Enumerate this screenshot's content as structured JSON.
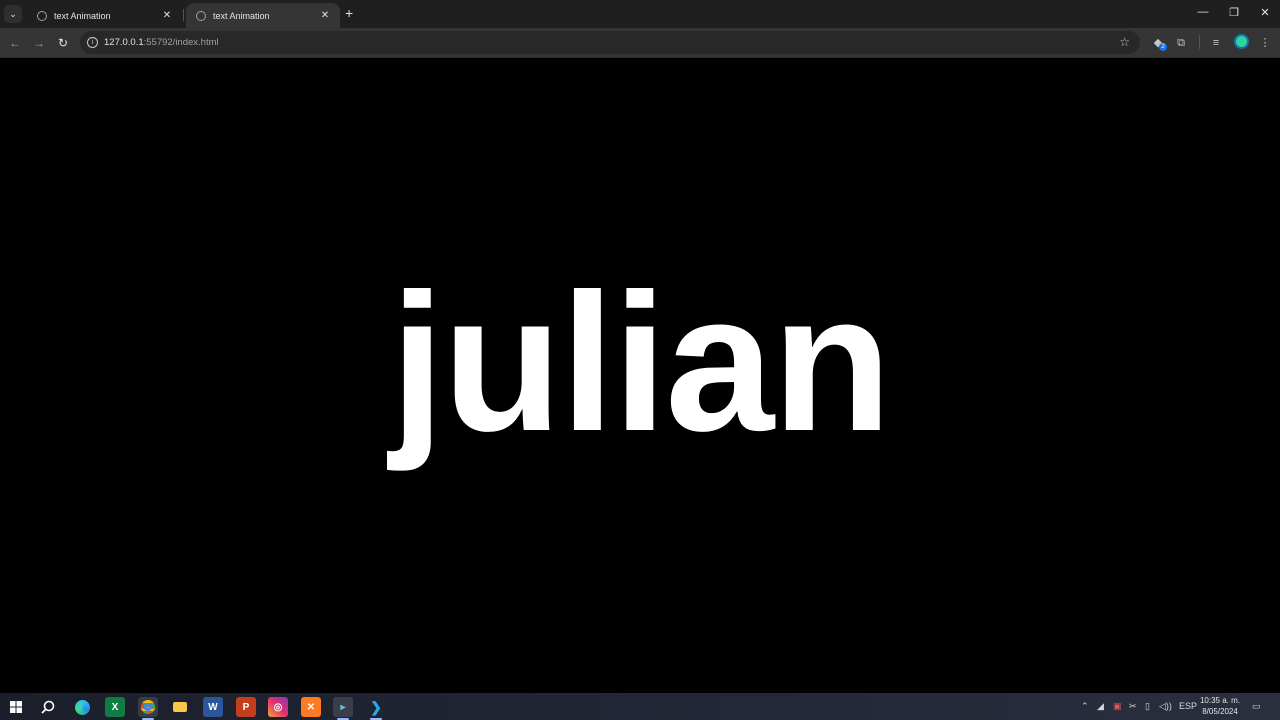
{
  "tabs": [
    {
      "title": "text Animation",
      "close": "✕"
    },
    {
      "title": "text Animation",
      "close": "✕"
    }
  ],
  "new_tab_glyph": "+",
  "window_controls": {
    "minimize": "—",
    "restore": "❐",
    "close": "✕"
  },
  "toolbar": {
    "back": "←",
    "forward": "→",
    "reload": "↻",
    "menu": "⋮",
    "star": "☆",
    "extensions_badge": "2"
  },
  "address_bar": {
    "host": "127.0.0.1",
    "path": ":55792/index.html"
  },
  "page": {
    "word": "julian",
    "background": "#000000",
    "text_color": "#ffffff"
  },
  "taskbar": {
    "apps": [
      "start-icon",
      "search-icon",
      "edge-icon",
      "excel-icon",
      "chrome-icon",
      "file-explorer-icon",
      "word-icon",
      "powerpoint-icon",
      "instagram-icon",
      "xampp-icon",
      "terminal-icon",
      "vscode-icon"
    ],
    "tray": {
      "language": "ESP",
      "time": "10:35 a. m.",
      "date": "8/05/2024"
    }
  },
  "colors": {
    "tabstrip": "#1f1f1f",
    "toolbar": "#353535",
    "omnibox": "#282828",
    "profile_accent": "#2dd4a0"
  }
}
